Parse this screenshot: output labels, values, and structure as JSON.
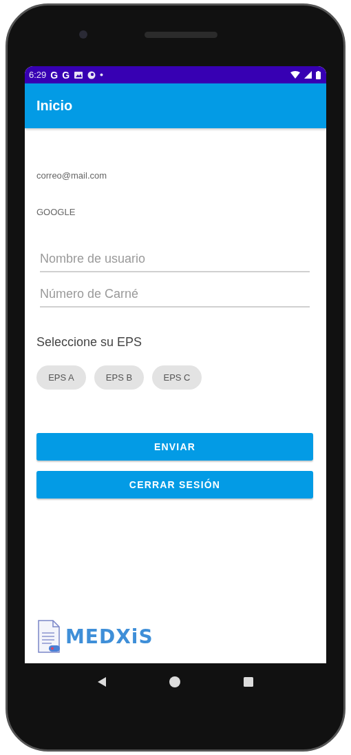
{
  "status_bar": {
    "time": "6:29",
    "notification_glyphs": [
      "G",
      "G"
    ]
  },
  "app_bar": {
    "title": "Inicio"
  },
  "account": {
    "email": "correo@mail.com",
    "provider": "GOOGLE"
  },
  "fields": [
    {
      "placeholder": "Nombre de usuario"
    },
    {
      "placeholder": "Número de Carné"
    }
  ],
  "eps": {
    "label": "Seleccione su EPS",
    "chips": [
      {
        "label": "EPS A",
        "selected": false
      },
      {
        "label": "EPS B",
        "selected": false
      },
      {
        "label": "EPS C",
        "selected": false
      }
    ]
  },
  "buttons": [
    "ENVIAR",
    "CERRAR SESIÓN"
  ],
  "logo": {
    "text": "MEDXiS"
  }
}
